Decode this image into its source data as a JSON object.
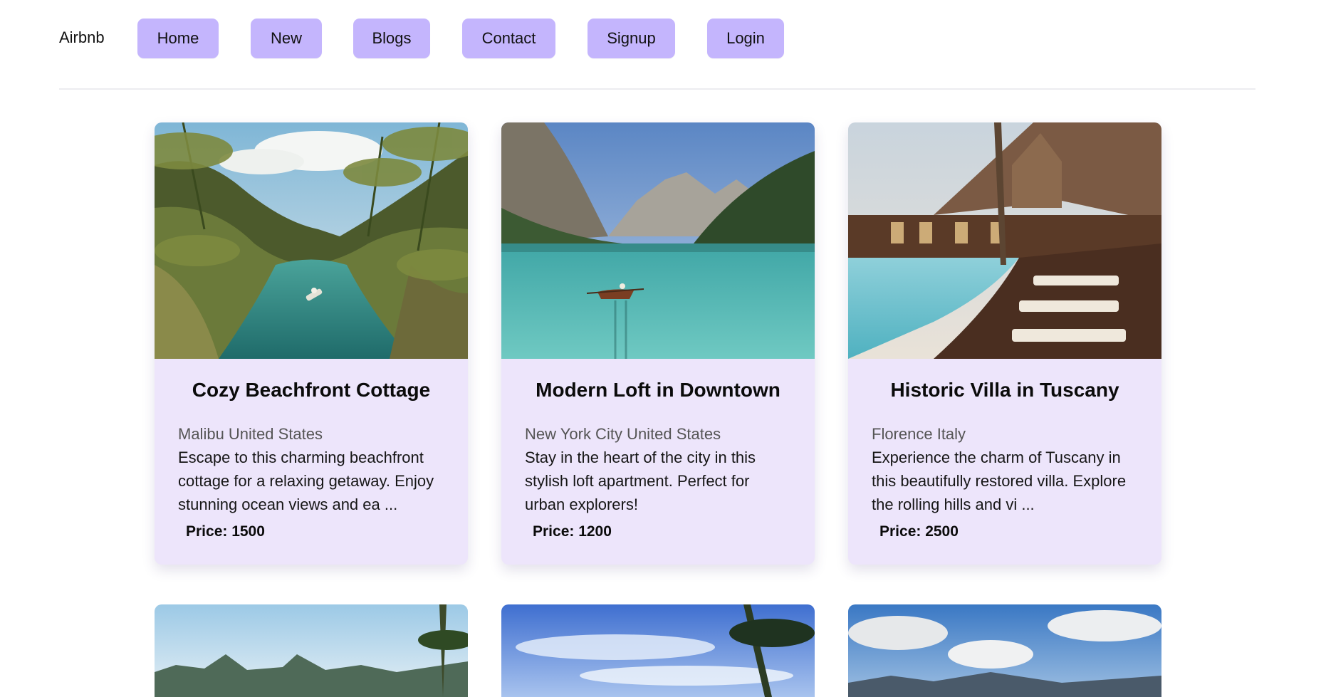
{
  "nav": {
    "brand": "Airbnb",
    "items": [
      {
        "label": "Home"
      },
      {
        "label": "New"
      },
      {
        "label": "Blogs"
      },
      {
        "label": "Contact"
      },
      {
        "label": "Signup"
      },
      {
        "label": "Login"
      }
    ]
  },
  "colors": {
    "nav_button": "#c4b5fd",
    "card_background": "#ede5fb"
  },
  "listings": [
    {
      "title": "Cozy Beachfront Cottage",
      "location": "Malibu United States",
      "description": "Escape to this charming beachfront cottage for a relaxing getaway. Enjoy stunning ocean views and ea ...",
      "price": "Price: 1500"
    },
    {
      "title": "Modern Loft in Downtown",
      "location": "New York City United States",
      "description": "Stay in the heart of the city in this stylish loft apartment. Perfect for urban explorers!",
      "price": "Price: 1200"
    },
    {
      "title": "Historic Villa in Tuscany",
      "location": "Florence Italy",
      "description": "Experience the charm of Tuscany in this beautifully restored villa. Explore the rolling hills and vi ...",
      "price": "Price: 2500"
    }
  ]
}
